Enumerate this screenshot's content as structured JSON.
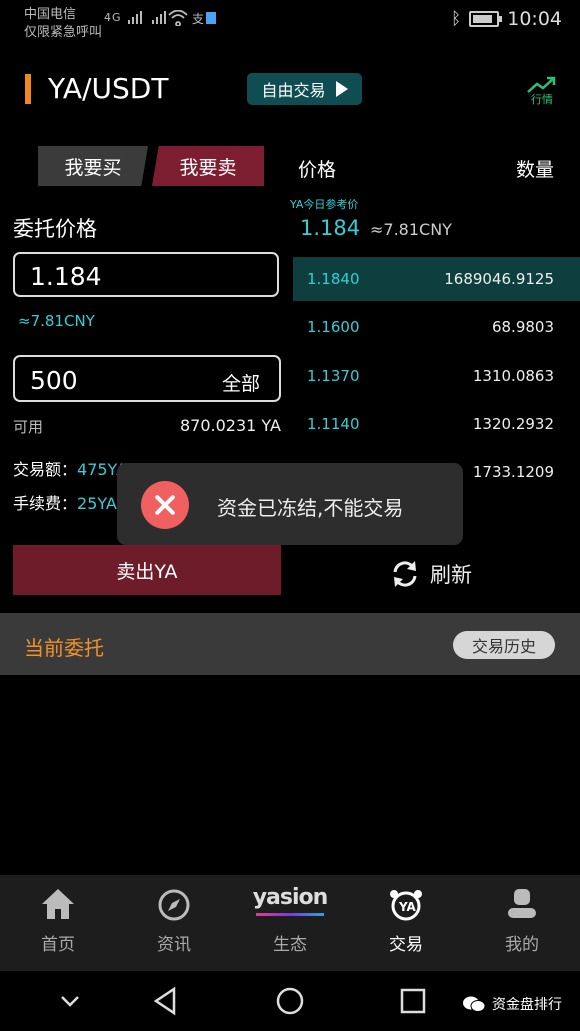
{
  "status_bar": {
    "carrier_line1": "中国电信",
    "carrier_line2": "仅限紧急呼叫",
    "signal_text": "4G",
    "time": "10:04"
  },
  "header": {
    "pair": "YA/USDT",
    "free_trade_label": "自由交易",
    "market_label": "行情"
  },
  "tabs": {
    "buy": "我要买",
    "sell": "我要卖"
  },
  "book_headers": {
    "price": "价格",
    "quantity": "数量"
  },
  "form": {
    "order_price_label": "委托价格",
    "price_value": "1.184",
    "cny_approx": "≈7.81CNY",
    "quantity_value": "500",
    "all_label": "全部",
    "available_label": "可用",
    "available_value": "870.0231 YA",
    "trade_amount_label": "交易额：",
    "trade_amount_value": "475YA",
    "fee_label": "手续费：",
    "fee_value": "25YA",
    "sell_button": "卖出YA"
  },
  "reference": {
    "label": "YA今日参考价",
    "price": "1.184",
    "cny": "≈7.81CNY"
  },
  "order_book": [
    {
      "price": "1.1840",
      "qty": "1689046.9125"
    },
    {
      "price": "1.1600",
      "qty": "68.9803"
    },
    {
      "price": "1.1370",
      "qty": "1310.0863"
    },
    {
      "price": "1.1140",
      "qty": "1320.2932"
    },
    {
      "price": "",
      "qty": "1733.1209"
    }
  ],
  "refresh_label": "刷新",
  "toast": {
    "message": "资金已冻结,不能交易"
  },
  "orders": {
    "title": "当前委托",
    "history_button": "交易历史"
  },
  "bottom_tabs": [
    {
      "label": "首页"
    },
    {
      "label": "资讯"
    },
    {
      "label": "生态",
      "logo_text": "yasion"
    },
    {
      "label": "交易"
    },
    {
      "label": "我的"
    }
  ],
  "watermark": "资金盘排行",
  "colors": {
    "accent_orange": "#f08a1e",
    "teal": "#2fd0d8",
    "sell_red": "#7d1e30",
    "free_trade_bg": "#0f4d52"
  }
}
